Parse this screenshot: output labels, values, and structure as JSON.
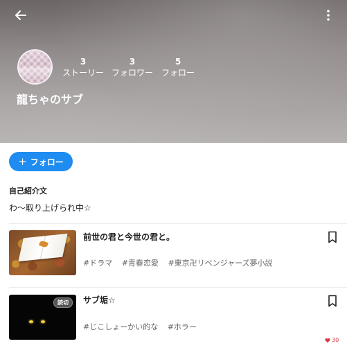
{
  "profile": {
    "name": "龍ちゃのサブ",
    "stats": [
      {
        "value": "3",
        "label": "ストーリー"
      },
      {
        "value": "3",
        "label": "フォロワー"
      },
      {
        "value": "5",
        "label": "フォロー"
      }
    ],
    "follow_button": "フォロー",
    "bio_title": "自己紹介文",
    "bio_text": "わ〜取り上げられ中☆"
  },
  "stories": [
    {
      "title": "前世の君と今世の君と。",
      "tags": [
        "#ドラマ",
        "#青春恋愛",
        "#東京卍リベンジャーズ夢小説"
      ]
    },
    {
      "title": "サブ垢☆",
      "badge": "読切",
      "tags": [
        "#じこしょーかい的な",
        "#ホラー"
      ],
      "likes": "30"
    }
  ],
  "colors": {
    "accent": "#1e8cf0",
    "like": "#d83a48"
  },
  "icons": {
    "back": "arrow-left-icon",
    "more": "more-vertical-icon",
    "bookmark": "bookmark-icon",
    "heart": "heart-icon",
    "plus": "plus-icon"
  }
}
